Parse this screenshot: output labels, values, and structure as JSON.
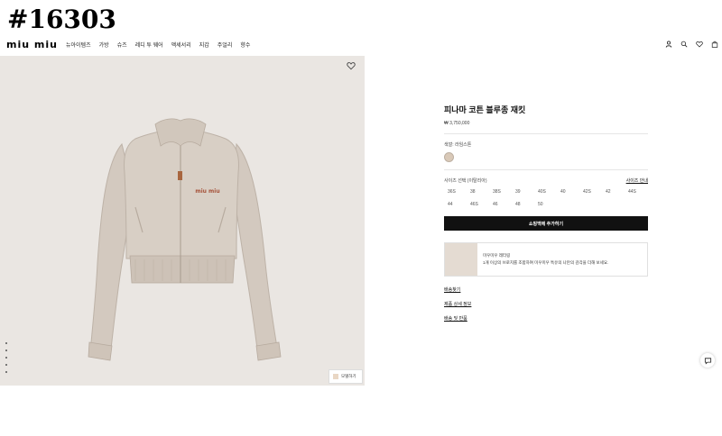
{
  "annotation": "#16303",
  "brand": {
    "logo": "miu miu"
  },
  "nav": {
    "items": [
      "뉴아이템즈",
      "가방",
      "슈즈",
      "레디 투 웨어",
      "액세서리",
      "지갑",
      "주얼리",
      "향수"
    ]
  },
  "header_icons": [
    "account-icon",
    "search-icon",
    "heart-icon",
    "bag-icon"
  ],
  "gallery": {
    "zoom_label": "모델하기",
    "dot_count": 5
  },
  "product": {
    "title": "피나마 코튼 블루종 재킷",
    "price": "₩ 3,750,000",
    "color_label": "색깔: 라임스톤",
    "size_heading": "사이즈 선택 (이탈리아)",
    "size_guide": "사이즈 안내",
    "sizes": [
      "36S",
      "38",
      "38S",
      "39",
      "40S",
      "40",
      "42S",
      "42",
      "44S",
      "44",
      "46S",
      "46",
      "48",
      "50"
    ],
    "add_to_cart": "쇼핑백에 추가하기",
    "combo_title": "미우미우 레터링",
    "combo_desc": "1개 이상의 브로치를 조합하여 미우미우 특유의 나만의 감각을 더해 보세요.",
    "links": [
      "배송찾기",
      "제품 상세 정보",
      "배송 및 반품"
    ]
  },
  "colors": {
    "hero_bg": "#eae6e2",
    "jacket": "#d6cdc3",
    "cta": "#111111",
    "swatch": "#d9c9b8"
  }
}
